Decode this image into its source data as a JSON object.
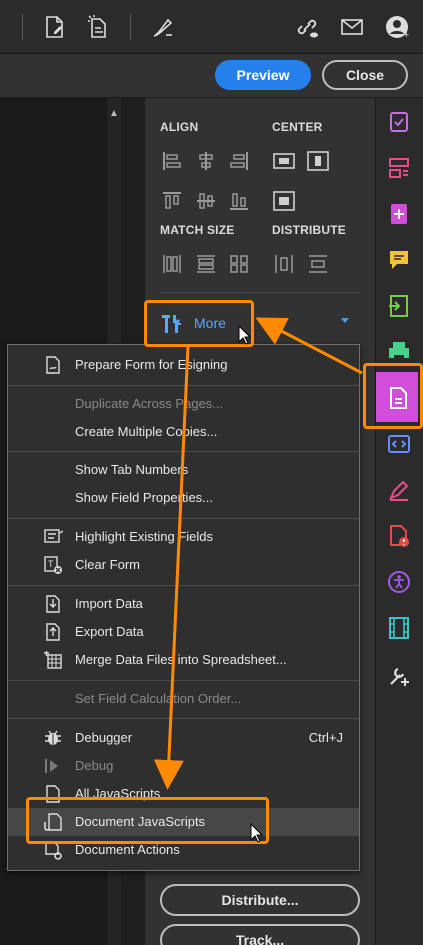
{
  "toolbar": {
    "icons": [
      "file-edit-icon",
      "file-magic-icon",
      "sign-pen-icon",
      "link-cloud-icon",
      "mail-icon",
      "account-icon"
    ]
  },
  "actions": {
    "preview_label": "Preview",
    "close_label": "Close"
  },
  "panel": {
    "align_label": "ALIGN",
    "center_label": "CENTER",
    "match_size_label": "MATCH SIZE",
    "distribute_label": "DISTRIBUTE",
    "more_label": "More",
    "distribute_button": "Distribute...",
    "track_button": "Track..."
  },
  "menu": {
    "items": [
      {
        "label": "Prepare Form for Esigning",
        "shortcut": "",
        "enabled": true,
        "icon": "prepare-form-icon"
      },
      {
        "label": "Duplicate Across Pages...",
        "shortcut": "",
        "enabled": false,
        "icon": ""
      },
      {
        "label": "Create Multiple Copies...",
        "shortcut": "",
        "enabled": true,
        "icon": ""
      },
      {
        "label": "Show Tab Numbers",
        "shortcut": "",
        "enabled": true,
        "icon": ""
      },
      {
        "label": "Show Field Properties...",
        "shortcut": "",
        "enabled": true,
        "icon": ""
      },
      {
        "label": "Highlight Existing Fields",
        "shortcut": "",
        "enabled": true,
        "icon": "highlight-fields-icon"
      },
      {
        "label": "Clear Form",
        "shortcut": "",
        "enabled": true,
        "icon": "clear-form-icon"
      },
      {
        "label": "Import Data",
        "shortcut": "",
        "enabled": true,
        "icon": "import-data-icon"
      },
      {
        "label": "Export Data",
        "shortcut": "",
        "enabled": true,
        "icon": "export-data-icon"
      },
      {
        "label": "Merge Data Files into Spreadsheet...",
        "shortcut": "",
        "enabled": true,
        "icon": "merge-data-icon"
      },
      {
        "label": "Set Field Calculation Order...",
        "shortcut": "",
        "enabled": false,
        "icon": ""
      },
      {
        "label": "Debugger",
        "shortcut": "Ctrl+J",
        "enabled": true,
        "icon": "debugger-icon"
      },
      {
        "label": "Debug",
        "shortcut": "",
        "enabled": false,
        "icon": "debug-icon"
      },
      {
        "label": "All JavaScripts",
        "shortcut": "",
        "enabled": true,
        "icon": "all-javascripts-icon"
      },
      {
        "label": "Document JavaScripts",
        "shortcut": "",
        "enabled": true,
        "icon": "document-javascripts-icon"
      },
      {
        "label": "Document Actions",
        "shortcut": "",
        "enabled": true,
        "icon": "document-actions-icon"
      }
    ]
  },
  "rail": {
    "icons": [
      "checklist-icon",
      "organize-icon",
      "create-pdf-icon",
      "comment-icon",
      "export-pdf-icon",
      "print-production-icon",
      "prepare-form-icon",
      "javascript-icon",
      "fill-sign-icon",
      "accessibility-alert-icon",
      "accessibility-icon",
      "rich-media-icon",
      "more-tools-icon"
    ]
  },
  "colors": {
    "accent": "#2680eb",
    "highlight": "#ff8a00",
    "active_tool": "#d14fd8",
    "link_blue": "#5aa9ff"
  }
}
